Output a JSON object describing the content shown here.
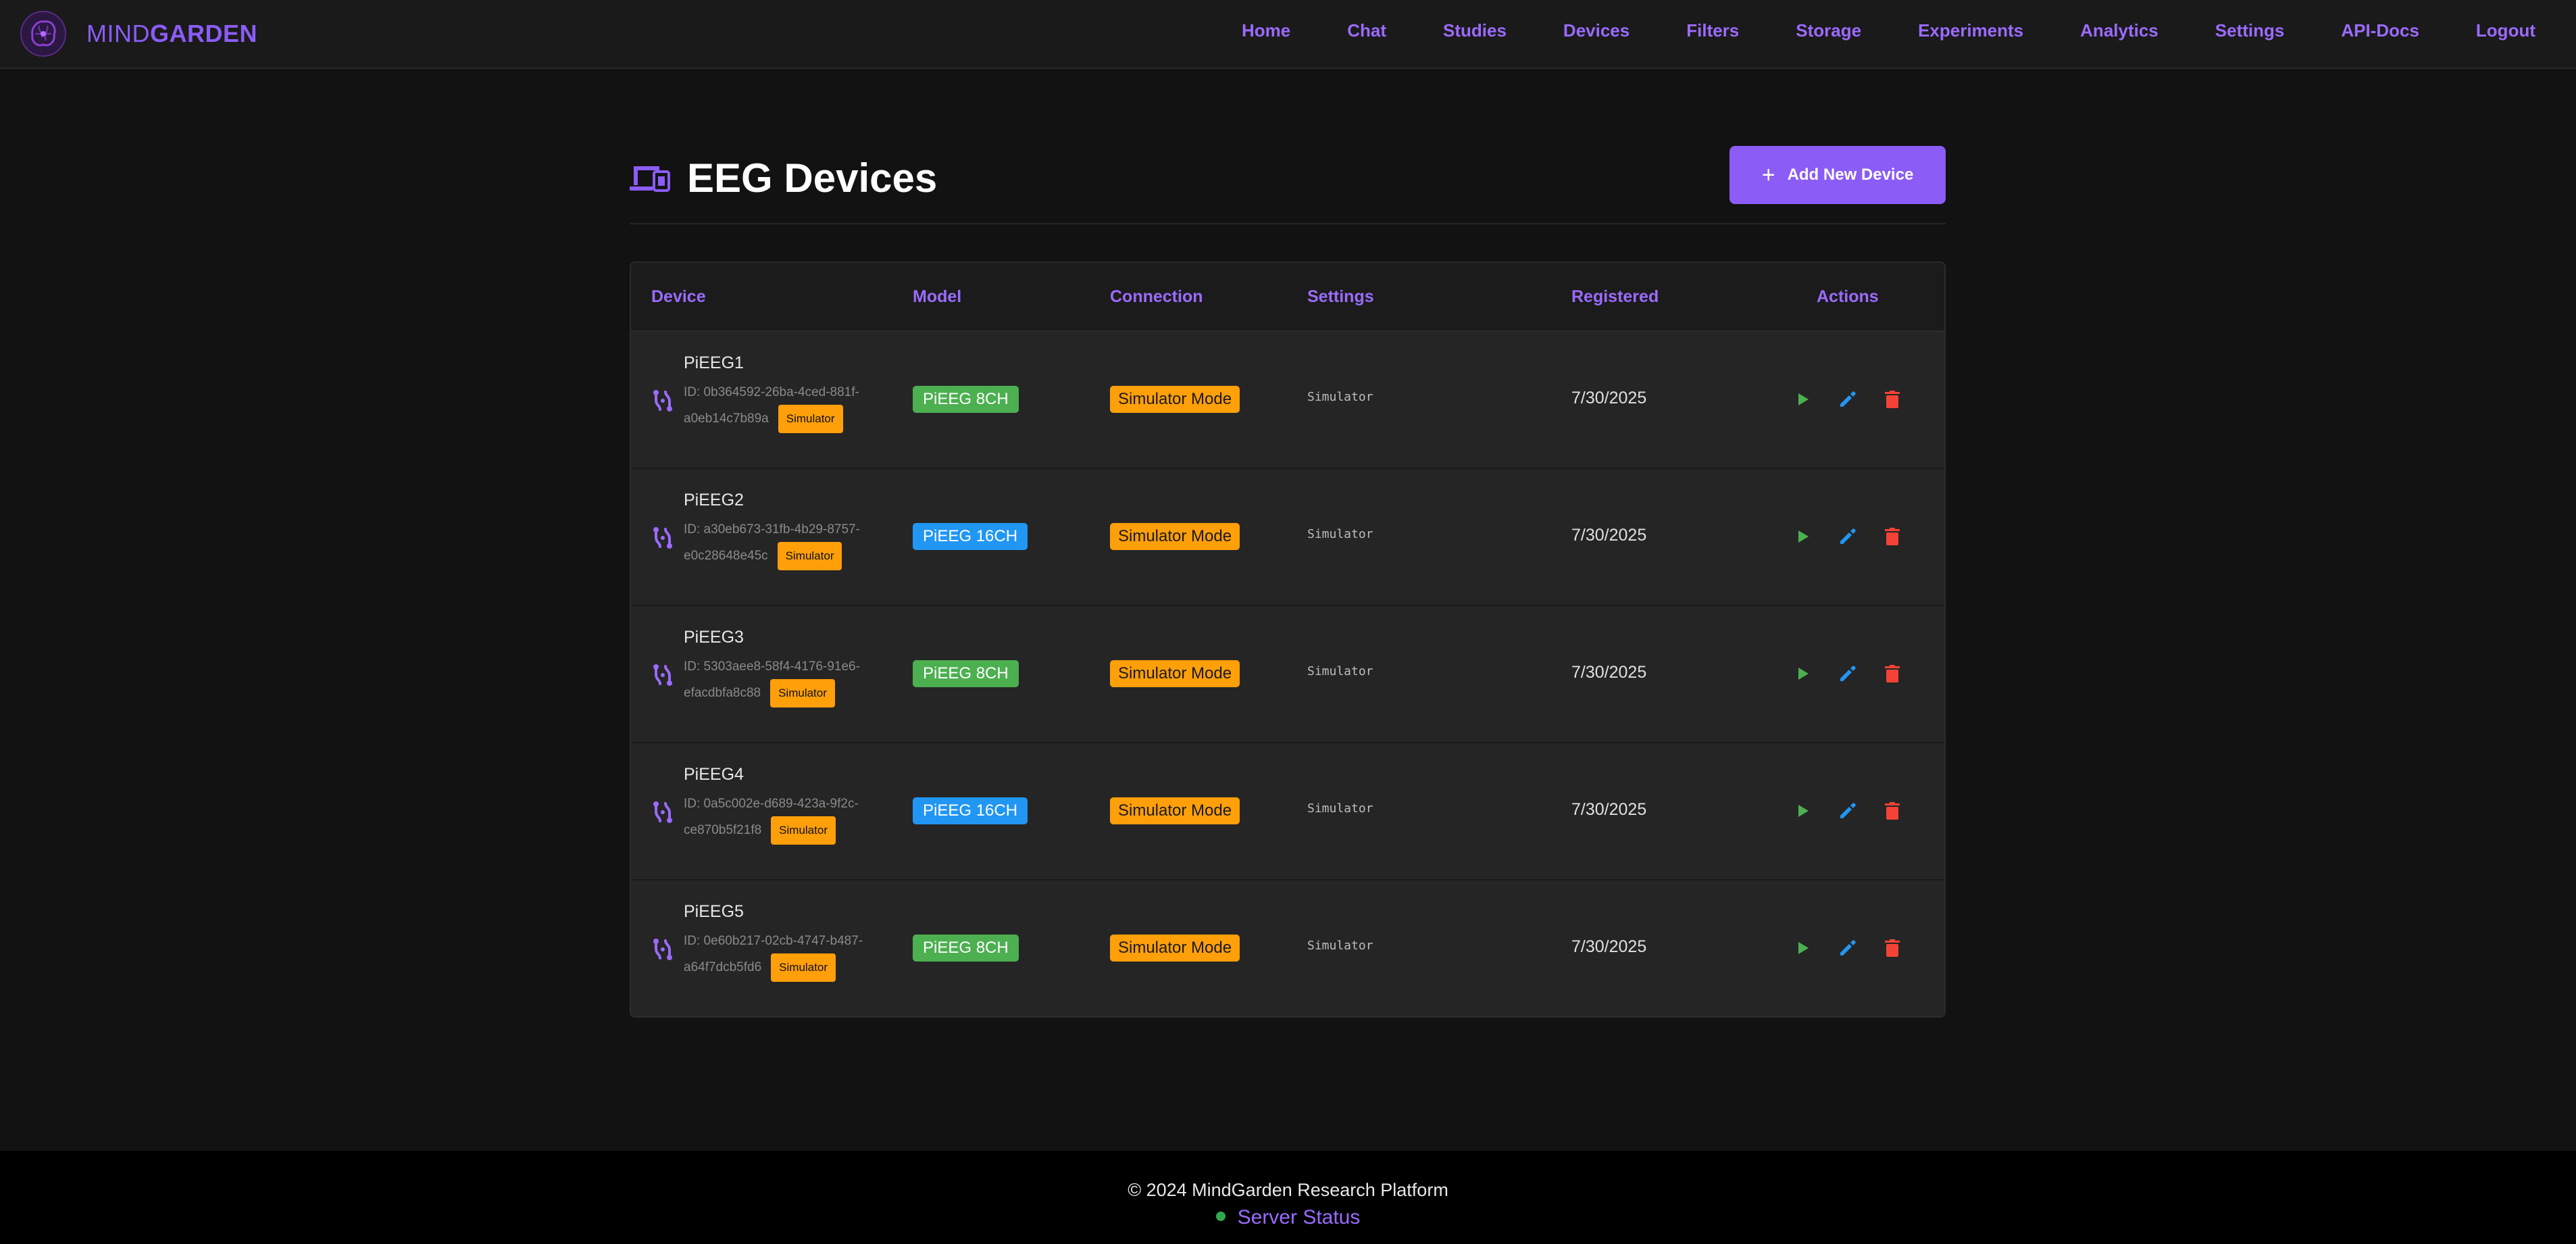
{
  "brand": {
    "part1": "MIND",
    "part2": "GARDEN"
  },
  "nav": [
    "Home",
    "Chat",
    "Studies",
    "Devices",
    "Filters",
    "Storage",
    "Experiments",
    "Analytics",
    "Settings",
    "API-Docs",
    "Logout"
  ],
  "header": {
    "title": "EEG Devices",
    "add_button": "Add New Device"
  },
  "table": {
    "columns": [
      "Device",
      "Model",
      "Connection",
      "Settings",
      "Registered",
      "Actions"
    ],
    "rows": [
      {
        "name": "PiEEG1",
        "id": "ID: 0b364592-26ba-4ced-881f-a0eb14c7b89a",
        "badge": "Simulator",
        "model": "PiEEG 8CH",
        "connection": "Simulator Mode",
        "settings": "Simulator",
        "registered": "7/30/2025"
      },
      {
        "name": "PiEEG2",
        "id": "ID: a30eb673-31fb-4b29-8757-e0c28648e45c",
        "badge": "Simulator",
        "model": "PiEEG 16CH",
        "connection": "Simulator Mode",
        "settings": "Simulator",
        "registered": "7/30/2025"
      },
      {
        "name": "PiEEG3",
        "id": "ID: 5303aee8-58f4-4176-91e6-efacdbfa8c88",
        "badge": "Simulator",
        "model": "PiEEG 8CH",
        "connection": "Simulator Mode",
        "settings": "Simulator",
        "registered": "7/30/2025"
      },
      {
        "name": "PiEEG4",
        "id": "ID: 0a5c002e-d689-423a-9f2c-ce870b5f21f8",
        "badge": "Simulator",
        "model": "PiEEG 16CH",
        "connection": "Simulator Mode",
        "settings": "Simulator",
        "registered": "7/30/2025"
      },
      {
        "name": "PiEEG5",
        "id": "ID: 0e60b217-02cb-4747-b487-a64f7dcb5fd6",
        "badge": "Simulator",
        "model": "PiEEG 8CH",
        "connection": "Simulator Mode",
        "settings": "Simulator",
        "registered": "7/30/2025"
      }
    ]
  },
  "footer": {
    "copyright": "© 2024 MindGarden Research Platform",
    "status": "Server Status"
  },
  "colors": {
    "accent": "#8b5cf6",
    "model_8ch": "#4caf50",
    "model_16ch": "#2196f3",
    "simulator": "#ff9f0a",
    "play": "#4caf50",
    "edit": "#2196f3",
    "delete": "#f44336",
    "status_online": "#2fa84f"
  },
  "icons": {
    "logo": "brain-logo-icon",
    "title": "devices-icon",
    "device": "device-hub-icon",
    "play": "play-icon",
    "edit": "pencil-icon",
    "delete": "trash-icon"
  }
}
